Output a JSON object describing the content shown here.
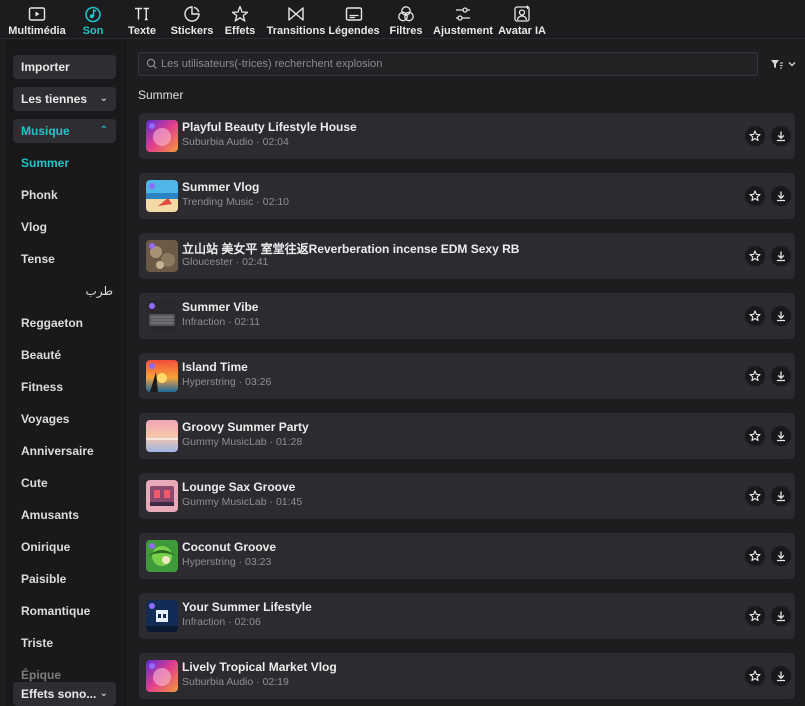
{
  "toolbar": {
    "tabs": [
      {
        "label": "Multimédia",
        "icon": "media-icon"
      },
      {
        "label": "Son",
        "icon": "music-note-icon",
        "active": true
      },
      {
        "label": "Texte",
        "icon": "text-icon"
      },
      {
        "label": "Stickers",
        "icon": "sticker-icon"
      },
      {
        "label": "Effets",
        "icon": "sparkle-star-icon"
      },
      {
        "label": "Transitions",
        "icon": "transition-icon"
      },
      {
        "label": "Légendes",
        "icon": "captions-icon"
      },
      {
        "label": "Filtres",
        "icon": "filter-circles-icon"
      },
      {
        "label": "Ajustement",
        "icon": "sliders-icon"
      },
      {
        "label": "Avatar IA",
        "icon": "ai-avatar-icon"
      }
    ]
  },
  "sidebar": {
    "import_label": "Importer",
    "yours_label": "Les tiennes",
    "music_label": "Musique",
    "categories": [
      "Summer",
      "Phonk",
      "Vlog",
      "Tense",
      "طرب",
      "Reggaeton",
      "Beauté",
      "Fitness",
      "Voyages",
      "Anniversaire",
      "Cute",
      "Amusants",
      "Onirique",
      "Paisible",
      "Romantique",
      "Triste",
      "Épique"
    ],
    "active_category": "Summer",
    "sound_effects_label": "Effets sono..."
  },
  "search": {
    "placeholder": "Les utilisateurs(-trices) recherchent explosion",
    "value": ""
  },
  "section_title": "Summer",
  "tracks": [
    {
      "title": "Playful Beauty Lifestyle House",
      "artist": "Suburbia Audio",
      "duration": "02:04"
    },
    {
      "title": "Summer Vlog",
      "artist": "Trending Music",
      "duration": "02:10"
    },
    {
      "title": "立山站 美女平 室堂往返Reverberation incense EDM Sexy RB",
      "artist": "Gloucester",
      "duration": "02:41"
    },
    {
      "title": "Summer Vibe",
      "artist": "Infraction",
      "duration": "02:11"
    },
    {
      "title": "Island Time",
      "artist": "Hyperstring",
      "duration": "03:26"
    },
    {
      "title": "Groovy Summer Party",
      "artist": "Gummy MusicLab",
      "duration": "01:28"
    },
    {
      "title": "Lounge Sax Groove",
      "artist": "Gummy MusicLab",
      "duration": "01:45"
    },
    {
      "title": "Coconut Groove",
      "artist": "Hyperstring",
      "duration": "03:23"
    },
    {
      "title": "Your Summer Lifestyle",
      "artist": "Infraction",
      "duration": "02:06"
    },
    {
      "title": "Lively Tropical Market Vlog",
      "artist": "Suburbia Audio",
      "duration": "02:19"
    }
  ],
  "meta_separator": " · ",
  "colors": {
    "accent": "#21c4c7",
    "background": "#1d1d20",
    "card": "#2c2c30",
    "sidebar": "#19191b"
  }
}
